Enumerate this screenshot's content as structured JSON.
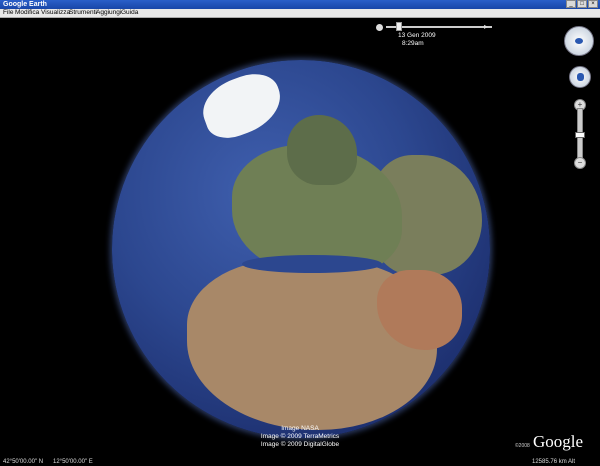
{
  "window": {
    "title": "Google Earth",
    "buttons": [
      "_",
      "□",
      "×"
    ]
  },
  "menu": [
    "File",
    "Modifica",
    "Visualizza",
    "Strumenti",
    "Aggiungi",
    "Guida"
  ],
  "time": {
    "date": "13 Gen 2009",
    "clock": "8:29am"
  },
  "attribution": {
    "line1": "Image NASA",
    "line2": "Image © 2009 TerraMetrics",
    "line3": "Image © 2009 DigitalGlobe",
    "copyright": "©2008",
    "logo": "Google"
  },
  "status": {
    "lat": "42°50'00.00\" N",
    "lon": "12°50'00.00\" E",
    "altitude": "12585.76 km Alt"
  },
  "icons": {
    "look": "eye-icon",
    "move": "hand-icon",
    "zoom_in": "plus-icon",
    "zoom_out": "minus-icon"
  }
}
